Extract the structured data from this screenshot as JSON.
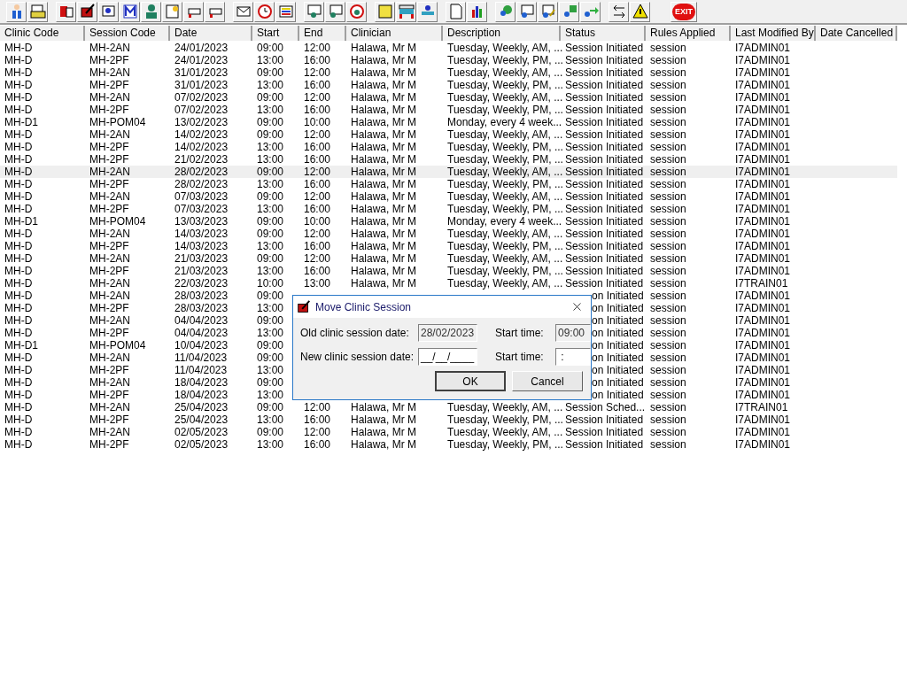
{
  "toolbar": {
    "exit_label": "EXIT"
  },
  "table": {
    "columns": [
      "Clinic Code",
      "Session Code",
      "Date",
      "Start",
      "End",
      "Clinician",
      "Description",
      "Status",
      "Rules Applied",
      "Last Modified By",
      "Date Cancelled"
    ],
    "rows": [
      {
        "clinic_code": "MH-D",
        "session_code": "MH-2AN",
        "date": "24/01/2023",
        "start": "09:00",
        "end": "12:00",
        "clinician": "Halawa, Mr M",
        "description": "Tuesday, Weekly, AM, ...",
        "status": "Session Initiated",
        "rules_applied": "session",
        "last_modified_by": "I7ADMIN01",
        "selected": false
      },
      {
        "clinic_code": "MH-D",
        "session_code": "MH-2PF",
        "date": "24/01/2023",
        "start": "13:00",
        "end": "16:00",
        "clinician": "Halawa, Mr M",
        "description": "Tuesday, Weekly, PM, ...",
        "status": "Session Initiated",
        "rules_applied": "session",
        "last_modified_by": "I7ADMIN01",
        "selected": false
      },
      {
        "clinic_code": "MH-D",
        "session_code": "MH-2AN",
        "date": "31/01/2023",
        "start": "09:00",
        "end": "12:00",
        "clinician": "Halawa, Mr M",
        "description": "Tuesday, Weekly, AM, ...",
        "status": "Session Initiated",
        "rules_applied": "session",
        "last_modified_by": "I7ADMIN01",
        "selected": false
      },
      {
        "clinic_code": "MH-D",
        "session_code": "MH-2PF",
        "date": "31/01/2023",
        "start": "13:00",
        "end": "16:00",
        "clinician": "Halawa, Mr M",
        "description": "Tuesday, Weekly, PM, ...",
        "status": "Session Initiated",
        "rules_applied": "session",
        "last_modified_by": "I7ADMIN01",
        "selected": false
      },
      {
        "clinic_code": "MH-D",
        "session_code": "MH-2AN",
        "date": "07/02/2023",
        "start": "09:00",
        "end": "12:00",
        "clinician": "Halawa, Mr M",
        "description": "Tuesday, Weekly, AM, ...",
        "status": "Session Initiated",
        "rules_applied": "session",
        "last_modified_by": "I7ADMIN01",
        "selected": false
      },
      {
        "clinic_code": "MH-D",
        "session_code": "MH-2PF",
        "date": "07/02/2023",
        "start": "13:00",
        "end": "16:00",
        "clinician": "Halawa, Mr M",
        "description": "Tuesday, Weekly, PM, ...",
        "status": "Session Initiated",
        "rules_applied": "session",
        "last_modified_by": "I7ADMIN01",
        "selected": false
      },
      {
        "clinic_code": "MH-D1",
        "session_code": "MH-POM04",
        "date": "13/02/2023",
        "start": "09:00",
        "end": "10:00",
        "clinician": "Halawa, Mr M",
        "description": "Monday, every 4 week...",
        "status": "Session Initiated",
        "rules_applied": "session",
        "last_modified_by": "I7ADMIN01",
        "selected": false
      },
      {
        "clinic_code": "MH-D",
        "session_code": "MH-2AN",
        "date": "14/02/2023",
        "start": "09:00",
        "end": "12:00",
        "clinician": "Halawa, Mr M",
        "description": "Tuesday, Weekly, AM, ...",
        "status": "Session Initiated",
        "rules_applied": "session",
        "last_modified_by": "I7ADMIN01",
        "selected": false
      },
      {
        "clinic_code": "MH-D",
        "session_code": "MH-2PF",
        "date": "14/02/2023",
        "start": "13:00",
        "end": "16:00",
        "clinician": "Halawa, Mr M",
        "description": "Tuesday, Weekly, PM, ...",
        "status": "Session Initiated",
        "rules_applied": "session",
        "last_modified_by": "I7ADMIN01",
        "selected": false
      },
      {
        "clinic_code": "MH-D",
        "session_code": "MH-2PF",
        "date": "21/02/2023",
        "start": "13:00",
        "end": "16:00",
        "clinician": "Halawa, Mr M",
        "description": "Tuesday, Weekly, PM, ...",
        "status": "Session Initiated",
        "rules_applied": "session",
        "last_modified_by": "I7ADMIN01",
        "selected": false
      },
      {
        "clinic_code": "MH-D",
        "session_code": "MH-2AN",
        "date": "28/02/2023",
        "start": "09:00",
        "end": "12:00",
        "clinician": "Halawa, Mr M",
        "description": "Tuesday, Weekly, AM, ...",
        "status": "Session Initiated",
        "rules_applied": "session",
        "last_modified_by": "I7ADMIN01",
        "selected": true
      },
      {
        "clinic_code": "MH-D",
        "session_code": "MH-2PF",
        "date": "28/02/2023",
        "start": "13:00",
        "end": "16:00",
        "clinician": "Halawa, Mr M",
        "description": "Tuesday, Weekly, PM, ...",
        "status": "Session Initiated",
        "rules_applied": "session",
        "last_modified_by": "I7ADMIN01",
        "selected": false
      },
      {
        "clinic_code": "MH-D",
        "session_code": "MH-2AN",
        "date": "07/03/2023",
        "start": "09:00",
        "end": "12:00",
        "clinician": "Halawa, Mr M",
        "description": "Tuesday, Weekly, AM, ...",
        "status": "Session Initiated",
        "rules_applied": "session",
        "last_modified_by": "I7ADMIN01",
        "selected": false
      },
      {
        "clinic_code": "MH-D",
        "session_code": "MH-2PF",
        "date": "07/03/2023",
        "start": "13:00",
        "end": "16:00",
        "clinician": "Halawa, Mr M",
        "description": "Tuesday, Weekly, PM, ...",
        "status": "Session Initiated",
        "rules_applied": "session",
        "last_modified_by": "I7ADMIN01",
        "selected": false
      },
      {
        "clinic_code": "MH-D1",
        "session_code": "MH-POM04",
        "date": "13/03/2023",
        "start": "09:00",
        "end": "10:00",
        "clinician": "Halawa, Mr M",
        "description": "Monday, every 4 week...",
        "status": "Session Initiated",
        "rules_applied": "session",
        "last_modified_by": "I7ADMIN01",
        "selected": false
      },
      {
        "clinic_code": "MH-D",
        "session_code": "MH-2AN",
        "date": "14/03/2023",
        "start": "09:00",
        "end": "12:00",
        "clinician": "Halawa, Mr M",
        "description": "Tuesday, Weekly, AM, ...",
        "status": "Session Initiated",
        "rules_applied": "session",
        "last_modified_by": "I7ADMIN01",
        "selected": false
      },
      {
        "clinic_code": "MH-D",
        "session_code": "MH-2PF",
        "date": "14/03/2023",
        "start": "13:00",
        "end": "16:00",
        "clinician": "Halawa, Mr M",
        "description": "Tuesday, Weekly, PM, ...",
        "status": "Session Initiated",
        "rules_applied": "session",
        "last_modified_by": "I7ADMIN01",
        "selected": false
      },
      {
        "clinic_code": "MH-D",
        "session_code": "MH-2AN",
        "date": "21/03/2023",
        "start": "09:00",
        "end": "12:00",
        "clinician": "Halawa, Mr M",
        "description": "Tuesday, Weekly, AM, ...",
        "status": "Session Initiated",
        "rules_applied": "session",
        "last_modified_by": "I7ADMIN01",
        "selected": false
      },
      {
        "clinic_code": "MH-D",
        "session_code": "MH-2PF",
        "date": "21/03/2023",
        "start": "13:00",
        "end": "16:00",
        "clinician": "Halawa, Mr M",
        "description": "Tuesday, Weekly, PM, ...",
        "status": "Session Initiated",
        "rules_applied": "session",
        "last_modified_by": "I7ADMIN01",
        "selected": false
      },
      {
        "clinic_code": "MH-D",
        "session_code": "MH-2AN",
        "date": "22/03/2023",
        "start": "10:00",
        "end": "13:00",
        "clinician": "Halawa, Mr M",
        "description": "Tuesday, Weekly, AM, ...",
        "status": "Session Initiated",
        "rules_applied": "session",
        "last_modified_by": "I7TRAIN01",
        "selected": false
      },
      {
        "clinic_code": "MH-D",
        "session_code": "MH-2AN",
        "date": "28/03/2023",
        "start": "09:00",
        "status": "on Initiated",
        "rules_applied": "session",
        "last_modified_by": "I7ADMIN01",
        "selected": false
      },
      {
        "clinic_code": "MH-D",
        "session_code": "MH-2PF",
        "date": "28/03/2023",
        "start": "13:00",
        "status": "on Initiated",
        "rules_applied": "session",
        "last_modified_by": "I7ADMIN01",
        "selected": false
      },
      {
        "clinic_code": "MH-D",
        "session_code": "MH-2AN",
        "date": "04/04/2023",
        "start": "09:00",
        "status": "on Initiated",
        "rules_applied": "session",
        "last_modified_by": "I7ADMIN01",
        "selected": false
      },
      {
        "clinic_code": "MH-D",
        "session_code": "MH-2PF",
        "date": "04/04/2023",
        "start": "13:00",
        "status": "on Initiated",
        "rules_applied": "session",
        "last_modified_by": "I7ADMIN01",
        "selected": false
      },
      {
        "clinic_code": "MH-D1",
        "session_code": "MH-POM04",
        "date": "10/04/2023",
        "start": "09:00",
        "status": "on Initiated",
        "rules_applied": "session",
        "last_modified_by": "I7ADMIN01",
        "selected": false
      },
      {
        "clinic_code": "MH-D",
        "session_code": "MH-2AN",
        "date": "11/04/2023",
        "start": "09:00",
        "status": "on Initiated",
        "rules_applied": "session",
        "last_modified_by": "I7ADMIN01",
        "selected": false
      },
      {
        "clinic_code": "MH-D",
        "session_code": "MH-2PF",
        "date": "11/04/2023",
        "start": "13:00",
        "status": "on Initiated",
        "rules_applied": "session",
        "last_modified_by": "I7ADMIN01",
        "selected": false
      },
      {
        "clinic_code": "MH-D",
        "session_code": "MH-2AN",
        "date": "18/04/2023",
        "start": "09:00",
        "status": "on Initiated",
        "rules_applied": "session",
        "last_modified_by": "I7ADMIN01",
        "selected": false
      },
      {
        "clinic_code": "MH-D",
        "session_code": "MH-2PF",
        "date": "18/04/2023",
        "start": "13:00",
        "status": "on Initiated",
        "rules_applied": "session",
        "last_modified_by": "I7ADMIN01",
        "selected": false
      },
      {
        "clinic_code": "MH-D",
        "session_code": "MH-2AN",
        "date": "25/04/2023",
        "start": "09:00",
        "end": "12:00",
        "clinician": "Halawa, Mr M",
        "description": "Tuesday, Weekly, AM, ...",
        "status": "Session Sched...",
        "rules_applied": "session",
        "last_modified_by": "I7TRAIN01",
        "selected": false
      },
      {
        "clinic_code": "MH-D",
        "session_code": "MH-2PF",
        "date": "25/04/2023",
        "start": "13:00",
        "end": "16:00",
        "clinician": "Halawa, Mr M",
        "description": "Tuesday, Weekly, PM, ...",
        "status": "Session Initiated",
        "rules_applied": "session",
        "last_modified_by": "I7ADMIN01",
        "selected": false
      },
      {
        "clinic_code": "MH-D",
        "session_code": "MH-2AN",
        "date": "02/05/2023",
        "start": "09:00",
        "end": "12:00",
        "clinician": "Halawa, Mr M",
        "description": "Tuesday, Weekly, AM, ...",
        "status": "Session Initiated",
        "rules_applied": "session",
        "last_modified_by": "I7ADMIN01",
        "selected": false
      },
      {
        "clinic_code": "MH-D",
        "session_code": "MH-2PF",
        "date": "02/05/2023",
        "start": "13:00",
        "end": "16:00",
        "clinician": "Halawa, Mr M",
        "description": "Tuesday, Weekly, PM, ...",
        "status": "Session Initiated",
        "rules_applied": "session",
        "last_modified_by": "I7ADMIN01",
        "selected": false
      }
    ]
  },
  "dialog": {
    "title": "Move Clinic Session",
    "fields": [
      {
        "label": "Old clinic session date:",
        "value": "28/02/2023",
        "disabled": true
      },
      {
        "label": "Start time:",
        "value": "09:00",
        "disabled": true
      },
      {
        "label": "New clinic session date:",
        "value": "__/__/____",
        "disabled": false
      },
      {
        "label": "Start time:",
        "value": " : ",
        "disabled": false
      }
    ],
    "buttons": [
      {
        "label": "OK",
        "default": true
      },
      {
        "label": "Cancel",
        "default": false
      }
    ]
  }
}
